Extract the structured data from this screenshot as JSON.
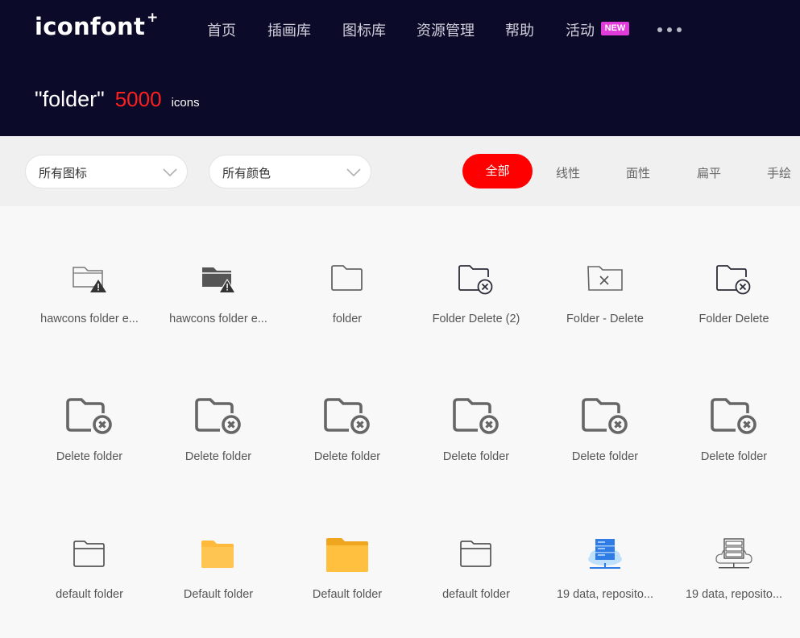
{
  "brand": {
    "logo_text": "iconfont",
    "logo_plus": "+"
  },
  "nav": {
    "items": [
      {
        "label": "首页"
      },
      {
        "label": "插画库"
      },
      {
        "label": "图标库"
      },
      {
        "label": "资源管理"
      },
      {
        "label": "帮助"
      },
      {
        "label": "活动"
      }
    ],
    "new_badge": "NEW",
    "more_icon": "more-dots-icon"
  },
  "search": {
    "query": "\"folder\"",
    "count": "5000",
    "unit": "icons"
  },
  "filters": {
    "icon_type": {
      "selected": "所有图标",
      "icon": "chevron-down-icon"
    },
    "color": {
      "selected": "所有颜色",
      "icon": "chevron-down-icon"
    },
    "styles": [
      {
        "label": "全部",
        "active": true
      },
      {
        "label": "线性",
        "active": false
      },
      {
        "label": "面性",
        "active": false
      },
      {
        "label": "扁平",
        "active": false
      },
      {
        "label": "手绘",
        "active": false
      }
    ],
    "active_color": "#ff0000"
  },
  "results": [
    {
      "name": "hawcons folder e...",
      "icon": "folder-warning-outline-icon"
    },
    {
      "name": "hawcons folder e...",
      "icon": "folder-warning-filled-icon"
    },
    {
      "name": "folder",
      "icon": "folder-outline-icon"
    },
    {
      "name": "Folder Delete (2)",
      "icon": "folder-delete-icon"
    },
    {
      "name": "Folder - Delete",
      "icon": "folder-x-icon"
    },
    {
      "name": "Folder Delete",
      "icon": "folder-delete-icon"
    },
    {
      "name": "Delete folder",
      "icon": "folder-delete-bold-icon"
    },
    {
      "name": "Delete folder",
      "icon": "folder-delete-bold-icon"
    },
    {
      "name": "Delete folder",
      "icon": "folder-delete-bold-icon"
    },
    {
      "name": "Delete folder",
      "icon": "folder-delete-bold-icon"
    },
    {
      "name": "Delete folder",
      "icon": "folder-delete-bold-icon"
    },
    {
      "name": "Delete folder",
      "icon": "folder-delete-bold-icon"
    },
    {
      "name": "default folder",
      "icon": "folder-simple-outline-icon"
    },
    {
      "name": "Default folder",
      "icon": "folder-yellow-icon"
    },
    {
      "name": "Default folder",
      "icon": "folder-yellow-large-icon"
    },
    {
      "name": "default folder",
      "icon": "folder-simple-outline-icon"
    },
    {
      "name": "19 data, reposito...",
      "icon": "cloud-server-blue-icon"
    },
    {
      "name": "19 data, reposito...",
      "icon": "cloud-server-outline-icon"
    }
  ],
  "colors": {
    "header_bg": "#0c0a29",
    "count_red": "#ff1f1f",
    "folder_yellow": "#ffb93b",
    "server_blue": "#2f7ce6",
    "icon_gray": "#555555"
  }
}
